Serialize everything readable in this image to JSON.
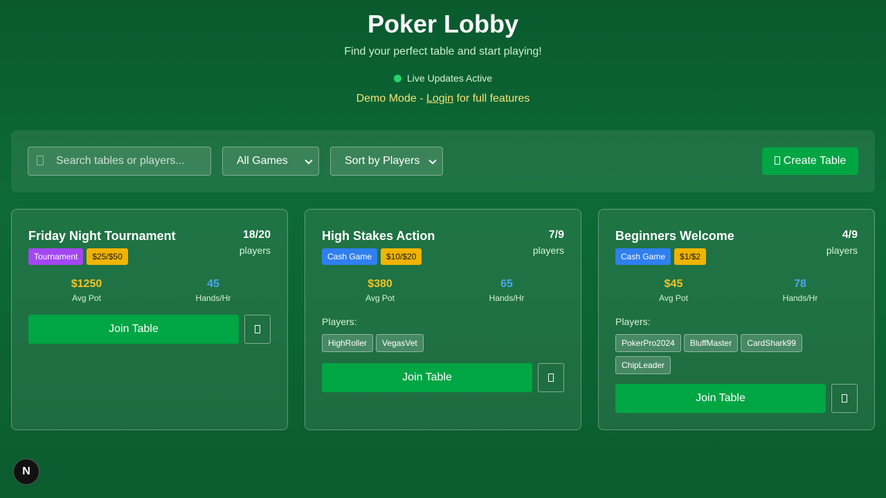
{
  "header": {
    "title": "Poker Lobby",
    "subtitle": "Find your perfect table and start playing!",
    "live_status": "Live Updates Active",
    "demo_prefix": "Demo Mode - ",
    "demo_link": "Login",
    "demo_suffix": " for full features"
  },
  "toolbar": {
    "search_placeholder": "Search tables or players...",
    "game_filter": "All Games",
    "sort": "Sort by Players",
    "create_label": "Create Table"
  },
  "tables": [
    {
      "name": "Friday Night Tournament",
      "count": "18/20",
      "players_label": "players",
      "type": "Tournament",
      "stakes": "$25/$50",
      "avg_pot": "$1250",
      "avg_pot_label": "Avg Pot",
      "hands": "45",
      "hands_label": "Hands/Hr",
      "join_label": "Join Table"
    },
    {
      "name": "High Stakes Action",
      "count": "7/9",
      "players_label": "players",
      "type": "Cash Game",
      "stakes": "$10/$20",
      "avg_pot": "$380",
      "avg_pot_label": "Avg Pot",
      "hands": "65",
      "hands_label": "Hands/Hr",
      "players_header": "Players:",
      "players": [
        "HighRoller",
        "VegasVet"
      ],
      "join_label": "Join Table"
    },
    {
      "name": "Beginners Welcome",
      "count": "4/9",
      "players_label": "players",
      "type": "Cash Game",
      "stakes": "$1/$2",
      "avg_pot": "$45",
      "avg_pot_label": "Avg Pot",
      "hands": "78",
      "hands_label": "Hands/Hr",
      "players_header": "Players:",
      "players": [
        "PokerPro2024",
        "BluffMaster",
        "CardShark99",
        "ChipLeader"
      ],
      "join_label": "Join Table"
    }
  ],
  "fab_label": "N",
  "colors": {
    "accent_green": "#00a544",
    "tournament": "#a347f0",
    "cash_game": "#2f7ff0",
    "stakes": "#f0b400",
    "pot": "#f6c325",
    "hands": "#4aa8f0",
    "live_dot": "#22d36a"
  }
}
